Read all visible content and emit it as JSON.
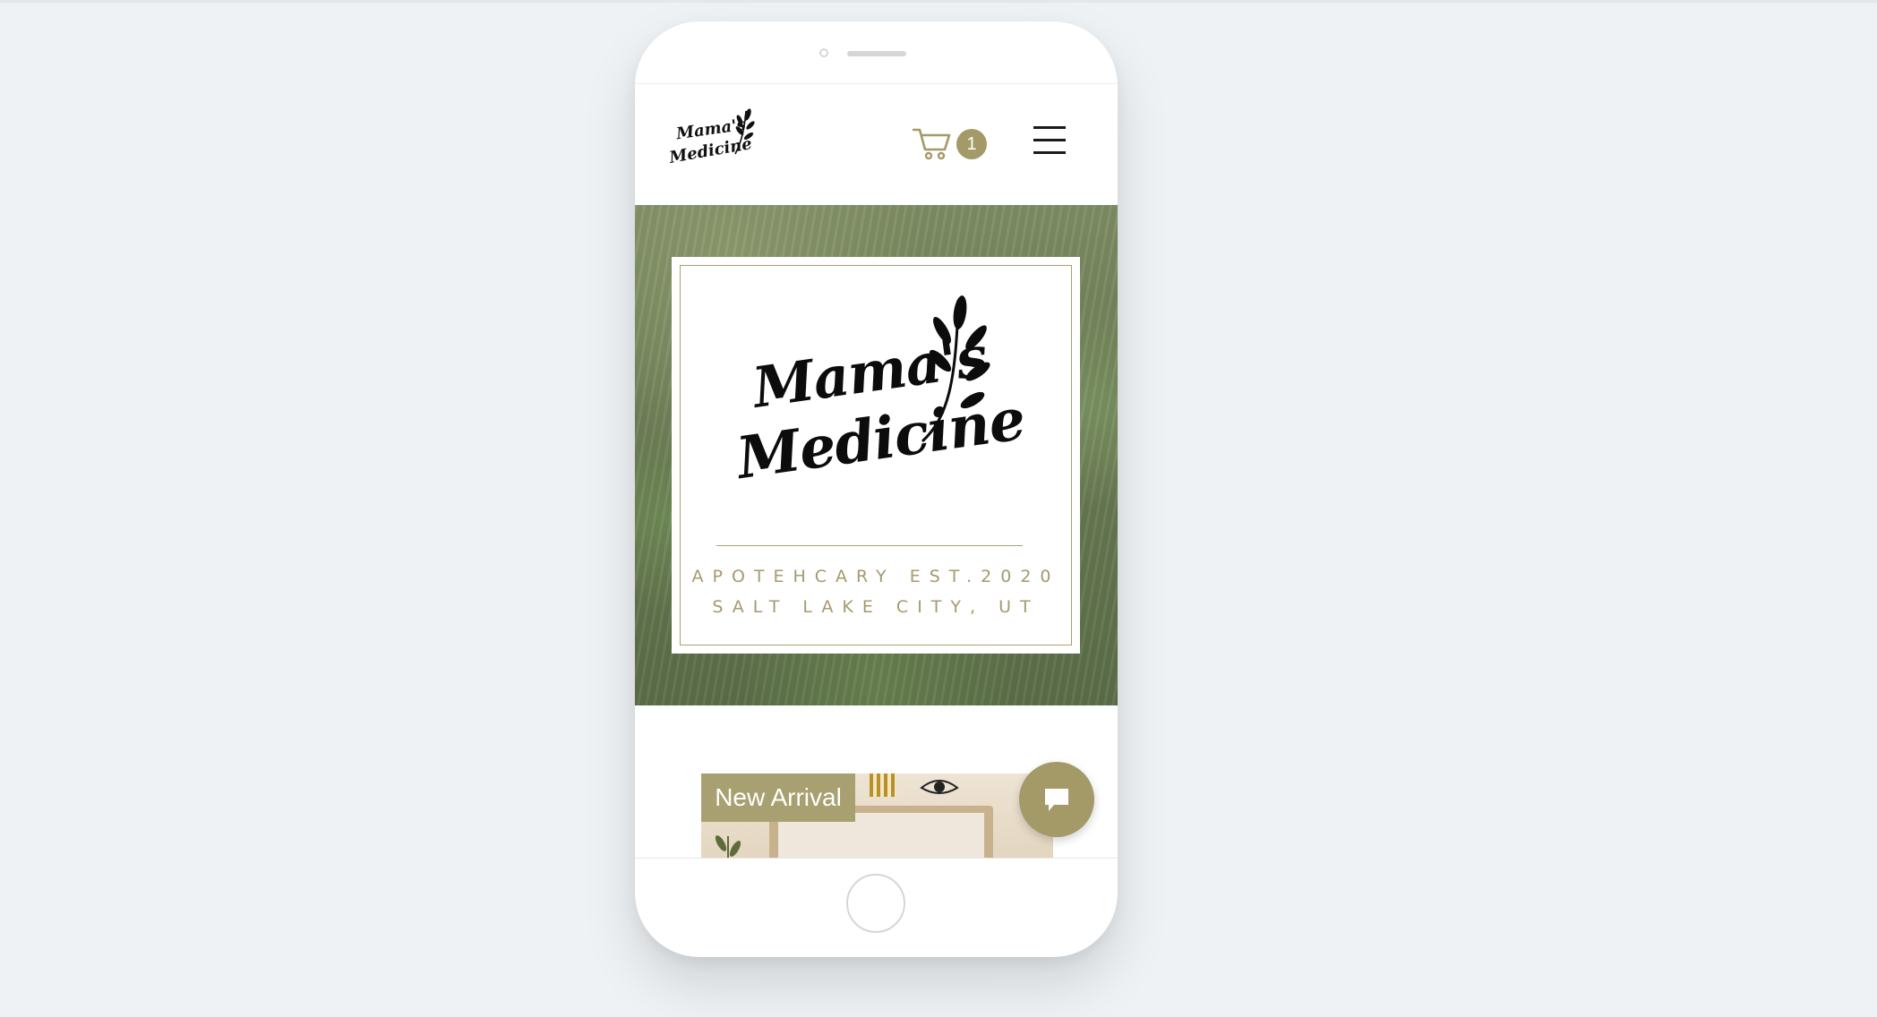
{
  "site": {
    "logo_line1": "Mama's",
    "logo_line2": "Medicine"
  },
  "header": {
    "cart_count": "1",
    "cart_icon": "cart-icon",
    "menu_icon": "hamburger-menu-icon"
  },
  "hero": {
    "logo_line1": "Mama's",
    "logo_line2": "Medicine",
    "tagline_1": "APOTEHCARY EST.2020",
    "tagline_2": "SALT LAKE CITY, UT"
  },
  "products": {
    "badge": "New Arrival"
  },
  "chat": {
    "icon": "chat-bubble-icon"
  },
  "colors": {
    "accent": "#a49a68",
    "background": "#eef2f5",
    "text_dark": "#111111"
  }
}
